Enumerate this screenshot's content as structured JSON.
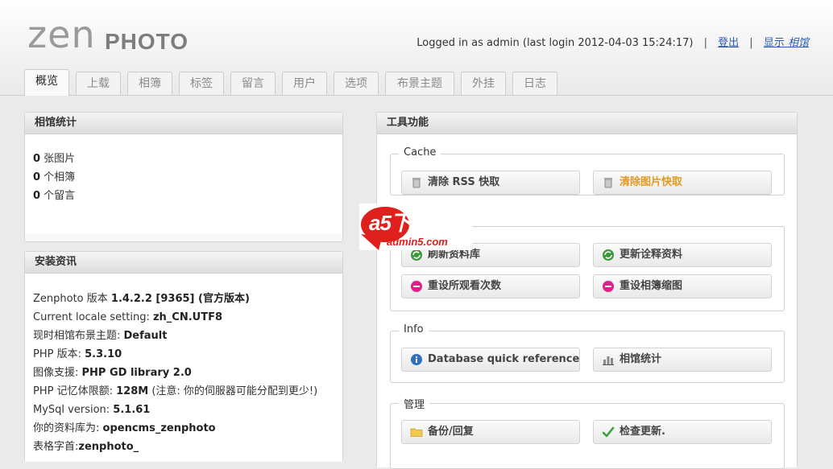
{
  "header": {
    "logo_zen": "zen",
    "logo_photo": "PHOTO",
    "login_text": "Logged in as admin (last login 2012-04-03 15:24:17)",
    "sep": "|",
    "logout": "登出",
    "show_label": "显示",
    "show_value": "相馆"
  },
  "tabs": [
    "概览",
    "上载",
    "相簿",
    "标签",
    "留言",
    "用户",
    "选项",
    "布景主题",
    "外挂",
    "日志"
  ],
  "stats": {
    "title": "相馆统计",
    "rows": [
      {
        "count": "0",
        "label": " 张图片"
      },
      {
        "count": "0",
        "label": " 个相簿"
      },
      {
        "count": "0",
        "label": " 个留言"
      }
    ]
  },
  "install": {
    "title": "安装资讯",
    "rows": [
      {
        "label": "Zenphoto 版本 ",
        "value": "1.4.2.2 [9365] (官方版本)",
        "extra": ""
      },
      {
        "label": "Current locale setting: ",
        "value": "zh_CN.UTF8",
        "extra": ""
      },
      {
        "label": "现时相馆布景主题: ",
        "value": "Default",
        "extra": ""
      },
      {
        "label": "PHP 版本: ",
        "value": "5.3.10",
        "extra": ""
      },
      {
        "label": "图像支援: ",
        "value": "PHP GD library 2.0",
        "extra": ""
      },
      {
        "label": "PHP 记忆体限额: ",
        "value": "128M",
        "extra": " (注意: 你的伺服器可能分配到更少!)"
      },
      {
        "label": "MySql version: ",
        "value": "5.1.61",
        "extra": ""
      },
      {
        "label": "你的资料库为: ",
        "value": "opencms_zenphoto",
        "extra": ""
      },
      {
        "label": "表格字首:",
        "value": "zenphoto_",
        "extra": ""
      }
    ]
  },
  "tools": {
    "title": "工具功能",
    "cache": {
      "legend": "Cache",
      "clear_rss": "清除 RSS 快取",
      "clear_image": "清除图片快取"
    },
    "database": {
      "refresh_db": "刷新资料库",
      "refresh_meta": "更新诠释资料",
      "reset_hits": "重设所观看次数",
      "reset_thumbs": "重设相簿缩图"
    },
    "info": {
      "legend": "Info",
      "db_ref": "Database quick reference",
      "gallery_stats": "相馆统计"
    },
    "admin": {
      "legend": "管理",
      "backup": "备份/回复",
      "check_update": "检查更新."
    }
  },
  "watermark": {
    "brand": "a5下载",
    "domain": "admin5.com"
  },
  "colors": {
    "link": "#2a5db0",
    "orange_button": "#e39a1c",
    "watermark_red": "#e0201c"
  }
}
